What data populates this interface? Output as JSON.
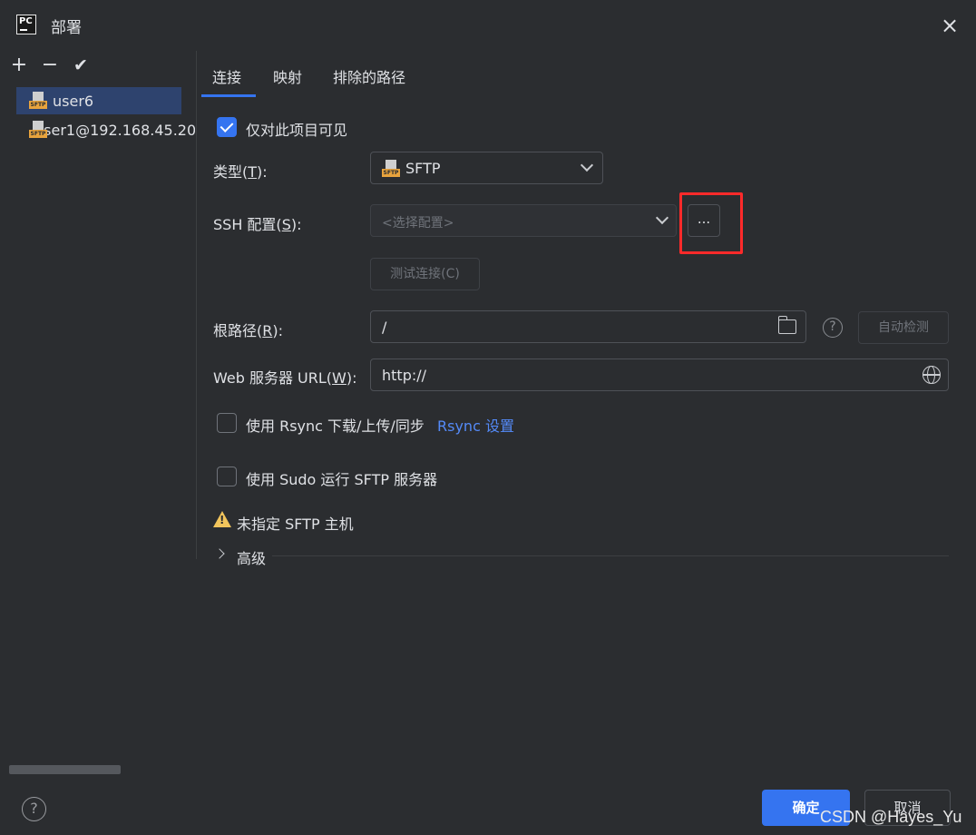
{
  "window": {
    "title": "部署",
    "app_icon_text": "PC",
    "close_glyph": "×"
  },
  "sidebar": {
    "toolbar": {
      "add": "+",
      "remove": "−",
      "apply": "✔"
    },
    "items": [
      {
        "label": "user6",
        "icon": "sftp-server-icon",
        "selected": true
      },
      {
        "label": "user1@192.168.45.20",
        "icon": "sftp-server-icon",
        "selected": false
      }
    ],
    "help_glyph": "?"
  },
  "tabs": [
    {
      "label": "连接",
      "active": true
    },
    {
      "label": "映射",
      "active": false
    },
    {
      "label": "排除的路径",
      "active": false
    }
  ],
  "connection": {
    "visible_only_project": {
      "label": "仅对此项目可见",
      "checked": true
    },
    "type": {
      "label_pre": "类型(",
      "label_key": "T",
      "label_post": "):",
      "value": "SFTP"
    },
    "ssh_config": {
      "label_pre": "SSH 配置(",
      "label_key": "S",
      "label_post": "):",
      "placeholder": "<选择配置>",
      "more_button": "..."
    },
    "test_connection": "测试连接(C)",
    "root_path": {
      "label_pre": "根路径(",
      "label_key": "R",
      "label_post": "):",
      "value": "/",
      "autodetect": "自动检测",
      "help_glyph": "?"
    },
    "web_url": {
      "label_pre": "Web 服务器 URL(",
      "label_key": "W",
      "label_post": "):",
      "value": "http://"
    },
    "rsync": {
      "label": "使用 Rsync 下载/上传/同步",
      "checked": false,
      "link": "Rsync 设置"
    },
    "sudo": {
      "label": "使用 Sudo 运行 SFTP 服务器",
      "checked": false
    },
    "warning": {
      "text": "未指定 SFTP 主机",
      "icon_glyph": "!"
    },
    "advanced": "高级"
  },
  "footer": {
    "ok": "确定",
    "cancel": "取消"
  },
  "watermark": "CSDN @Hayes_Yu",
  "colors": {
    "background": "#2b2d30",
    "accent": "#3574f0",
    "selection": "#2e436e",
    "link": "#548af7",
    "warning": "#f2c55c",
    "highlight_box": "#ff2a2a"
  }
}
